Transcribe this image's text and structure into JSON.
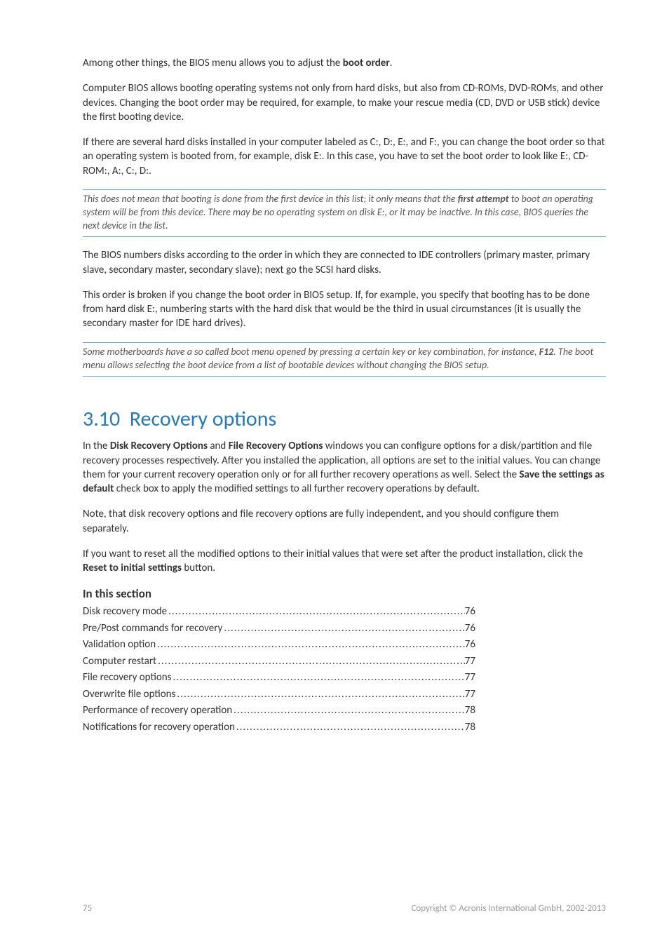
{
  "intro": {
    "p1_a": "Among other things, the BIOS menu allows you to adjust the ",
    "p1_b": "boot order",
    "p1_c": ".",
    "p2": "Computer BIOS allows booting operating systems not only from hard disks, but also from CD-ROMs, DVD-ROMs, and other devices. Changing the boot order may be required, for example, to make your rescue media (CD, DVD or USB stick) device the first booting device.",
    "p3": "If there are several hard disks installed in your computer labeled as C:, D:, E:, and F:, you can change the boot order so that an operating system is booted from, for example, disk E:. In this case, you have to set the boot order to look like E:, CD-ROM:, A:, C:, D:."
  },
  "note1": {
    "a": "This does not mean that booting is done from the first device in this list; it only means that the ",
    "b": "first attempt",
    "c": " to boot an operating system will be from this device. There may be no operating system on disk E:, or it may be inactive. In this case, BIOS queries the next device in the list."
  },
  "mid": {
    "p4": "The BIOS numbers disks according to the order in which they are connected to IDE controllers (primary master, primary slave, secondary master, secondary slave); next go the SCSI hard disks.",
    "p5": "This order is broken if you change the boot order in BIOS setup. If, for example, you specify that booting has to be done from hard disk E:, numbering starts with the hard disk that would be the third in usual circumstances (it is usually the secondary master for IDE hard drives)."
  },
  "note2": {
    "a": "Some motherboards have a so called boot menu opened by pressing a certain key or key combination, for instance, ",
    "b": "F12",
    "c": ". The boot menu allows selecting the boot device from a list of bootable devices without changing the BIOS setup."
  },
  "section": {
    "num": "3.10",
    "title": "Recovery options",
    "p1_a": "In the ",
    "p1_b": "Disk Recovery Options",
    "p1_c": " and ",
    "p1_d": "File Recovery Options",
    "p1_e": " windows you can configure options for a disk/partition and file recovery processes respectively. After you installed the application, all options are set to the initial values. You can change them for your current recovery operation only or for all further recovery operations as well. Select the ",
    "p1_f": "Save the settings as default",
    "p1_g": " check box to apply the modified settings to all further recovery operations by default.",
    "p2": "Note, that disk recovery options and file recovery options are fully independent, and you should configure them separately.",
    "p3_a": "If you want to reset all the modified options to their initial values that were set after the product installation, click the ",
    "p3_b": "Reset to initial settings",
    "p3_c": " button."
  },
  "toc_heading": "In this section",
  "toc": [
    {
      "label": "Disk recovery mode ",
      "page": "76"
    },
    {
      "label": "Pre/Post commands for recovery ",
      "page": "76"
    },
    {
      "label": "Validation option",
      "page": "76"
    },
    {
      "label": "Computer restart ",
      "page": "77"
    },
    {
      "label": "File recovery options",
      "page": "77"
    },
    {
      "label": "Overwrite file options ",
      "page": "77"
    },
    {
      "label": "Performance of recovery operation ",
      "page": "78"
    },
    {
      "label": "Notifications for recovery operation ",
      "page": "78"
    }
  ],
  "footer": {
    "page": "75",
    "copyright": "Copyright © Acronis International GmbH, 2002-2013"
  }
}
